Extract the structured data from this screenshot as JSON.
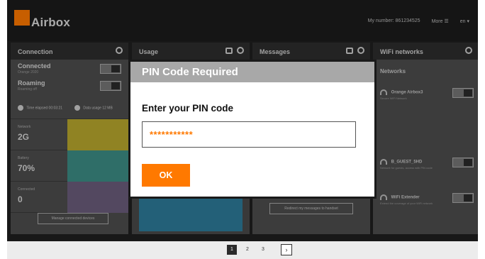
{
  "app": {
    "brand": "Airbox",
    "accent": "#ff7900"
  },
  "topbar": {
    "my_number": "My number: 861234525",
    "more": "More ☰",
    "lang": "en ▾"
  },
  "cards": {
    "connection": {
      "title": "Connection",
      "connected_label": "Connected",
      "connected_sub": "Orange 2020",
      "roaming_label": "Roaming",
      "roaming_sub": "Roaming off",
      "time_elapsed": "Time elapsed",
      "time_elapsed_value": "00:03:21",
      "data_usage": "Data usage",
      "data_usage_value": "12 MB",
      "network_label": "Network",
      "network_value": "2G",
      "battery_label": "Battery",
      "battery_value": "70%",
      "connected_devices_label": "Connected",
      "connected_devices_value": "0",
      "manage_button": "Manage connected devices"
    },
    "usage": {
      "title": "Usage"
    },
    "messages": {
      "title": "Messages",
      "redirect_button": "Redirect my messages to handset"
    },
    "wifi": {
      "title": "WiFi networks",
      "networks_label": "Networks",
      "net1_name": "Orange Airbox3",
      "net1_desc": "Secure WiFi Network",
      "net2_name": "B_GUEST_5HD",
      "net2_desc": "Network for guests, access with PIN code",
      "net3_name": "WiFi Extender",
      "net3_desc": "Extend the coverage of your WiFi network"
    }
  },
  "modal": {
    "title": "PIN Code Required",
    "prompt": "Enter your PIN code",
    "pin_value": "***********",
    "ok_label": "OK"
  },
  "pager": {
    "pages": [
      "1",
      "2",
      "3"
    ],
    "next": "›"
  }
}
